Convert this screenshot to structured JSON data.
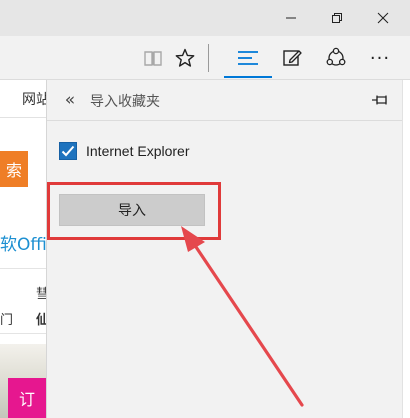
{
  "window_controls": {
    "minimize_icon": "minimize-icon",
    "maximize_icon": "restore-icon",
    "close_icon": "close-icon"
  },
  "toolbar": {
    "icons": [
      "reading-view-icon",
      "favorite-star-icon",
      "hub-icon",
      "web-note-icon",
      "share-icon",
      "more-icon"
    ],
    "more_label": "···",
    "accent_color": "#0078d7"
  },
  "page": {
    "nav_text": "网站",
    "search_button": "索",
    "office_text": "软Offi",
    "box_char_1": "彗",
    "box_char_2": "门",
    "box_char_3": "仙",
    "pink_button": "订"
  },
  "hub_panel": {
    "back_label": "«",
    "title": "导入收藏夹",
    "pin_icon": "pin-icon",
    "option_label": "Internet Explorer",
    "option_checked": true,
    "import_button": "导入"
  },
  "annotation": {
    "highlight_color": "#e03a3a"
  }
}
